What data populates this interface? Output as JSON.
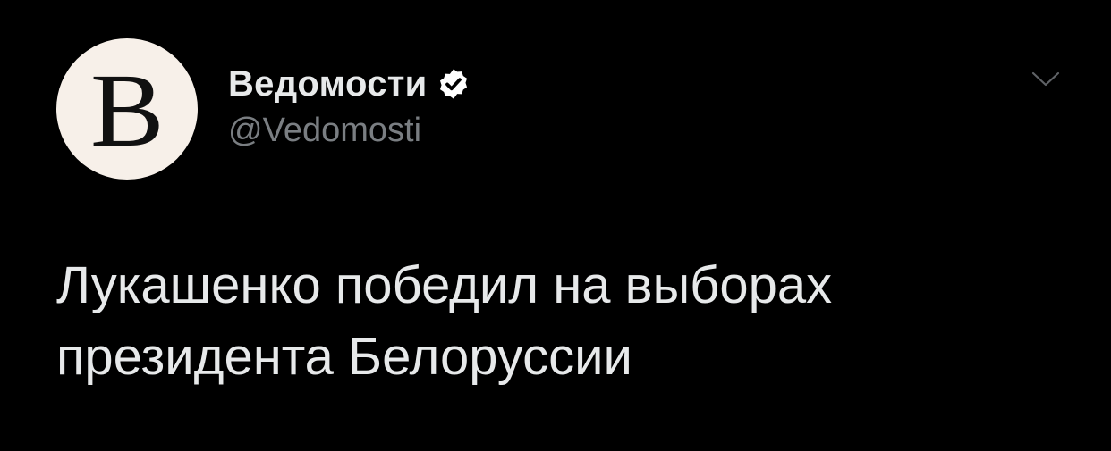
{
  "colors": {
    "background": "#000000",
    "text_primary": "#e7e9ea",
    "text_secondary": "#7a7e82",
    "avatar_bg": "#f7f0e9",
    "verified_badge": "#ffffff"
  },
  "author": {
    "avatar_letter": "B",
    "display_name": "Ведомости",
    "handle": "@Vedomosti",
    "verified_icon": "verified-badge-icon"
  },
  "menu": {
    "icon": "chevron-down-icon"
  },
  "tweet": {
    "lines": [
      "Лукашенко победил на выборах",
      "президента Белоруссии"
    ]
  }
}
